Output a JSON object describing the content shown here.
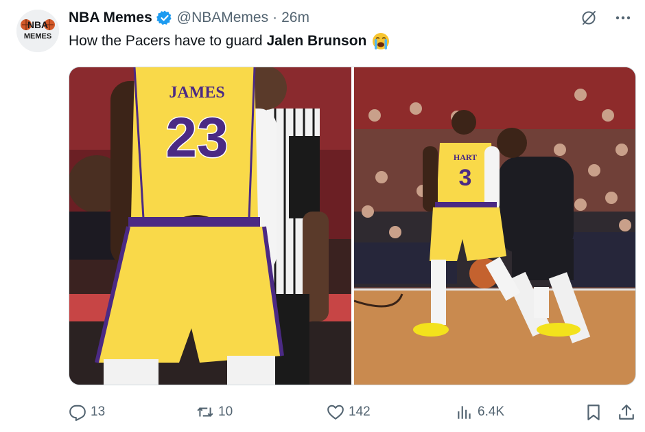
{
  "author": {
    "display_name": "NBA Memes",
    "handle": "@NBAMemes",
    "separator": "·",
    "time": "26m",
    "avatar_text_top": "NBA",
    "avatar_text_bottom": "MEMES"
  },
  "tweet": {
    "text_prefix": "How the Pacers have to guard",
    "text_bold": "Jalen Brunson",
    "emoji": "loudly-crying-face"
  },
  "media": {
    "left_jersey_name": "JAMES",
    "left_jersey_number": "23",
    "right_jersey_name": "HART",
    "right_jersey_number": "3"
  },
  "actions": {
    "replies": "13",
    "retweets": "10",
    "likes": "142",
    "views": "6.4K"
  },
  "colors": {
    "text_primary": "#0f1419",
    "text_secondary": "#536471",
    "verified": "#1d9bf0",
    "jersey_gold": "#f9d949",
    "jersey_purple": "#4b2a84",
    "court": "#c98a4f"
  },
  "icons": {
    "verified": "verified-badge-icon",
    "grok": "grok-icon",
    "more": "more-dots-icon",
    "reply": "reply-icon",
    "retweet": "retweet-icon",
    "like": "heart-icon",
    "views": "views-chart-icon",
    "bookmark": "bookmark-icon",
    "share": "share-icon"
  }
}
